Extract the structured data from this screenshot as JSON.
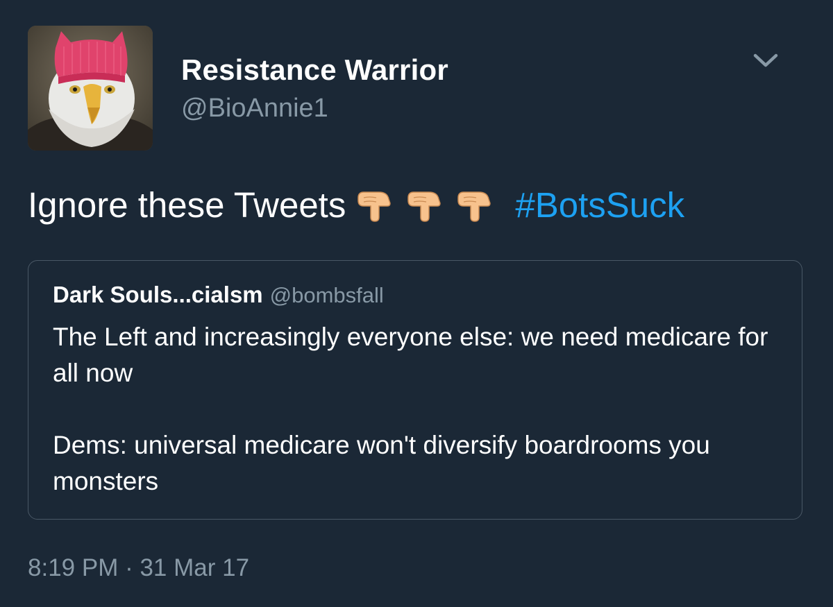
{
  "author": {
    "display_name": "Resistance Warrior",
    "handle": "@BioAnnie1",
    "avatar": "bald-eagle-pink-hat-avatar"
  },
  "menu": {
    "icon": "chevron-down-icon"
  },
  "tweet": {
    "text": "Ignore these Tweets",
    "emoji": [
      "backhand-index-pointing-down",
      "backhand-index-pointing-down",
      "backhand-index-pointing-down"
    ],
    "hashtag": "#BotsSuck"
  },
  "quoted_tweet": {
    "display_name": "Dark Souls...cialsm",
    "handle": "@bombsfall",
    "paragraphs": [
      "The Left and increasingly everyone else: we need medicare for all now",
      "Dems: universal medicare won't diversify boardrooms you monsters"
    ]
  },
  "timestamp": "8:19 PM · 31 Mar 17",
  "colors": {
    "background": "#1b2836",
    "hashtag": "#1da1f2",
    "secondary_text": "#8899a6",
    "border": "#4a5866"
  }
}
